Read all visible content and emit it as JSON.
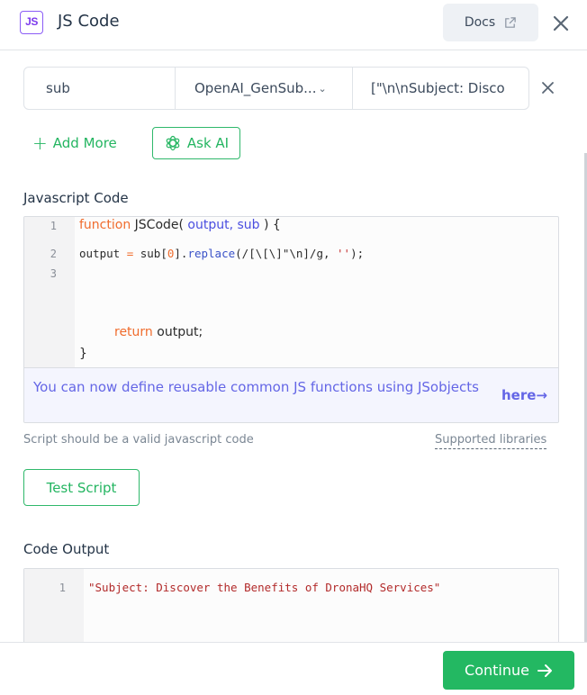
{
  "header": {
    "badge": "JS",
    "title": "JS Code",
    "docs_label": "Docs"
  },
  "params": [
    {
      "name": "sub",
      "source": "OpenAI_GenSub...",
      "value": "[\"\\n\\nSubject: Disco"
    }
  ],
  "actions": {
    "add_more": "Add More",
    "ask_ai": "Ask AI"
  },
  "editor": {
    "label": "Javascript Code",
    "line_numbers": [
      "1",
      "2",
      "3"
    ],
    "lines": {
      "l1_kw": "function",
      "l1_name": " JSCode( ",
      "l1_params": "output, sub",
      "l1_end": " ) {",
      "l2_a": "output ",
      "l2_eq": "=",
      "l2_b": " sub[",
      "l2_idx": "0",
      "l2_c": "].",
      "l2_fn": "replace",
      "l2_d": "(/[\\[\\]\"\\n]/g, ",
      "l2_str": "''",
      "l2_e": ");",
      "ret_kw": "return",
      "ret_rest": " output;",
      "close": "}"
    },
    "hint_text": "You can now define reusable common JS functions using JSobjects",
    "hint_link": "here→"
  },
  "helper_text": "Script should be a valid javascript code",
  "supported_libraries": "Supported libraries",
  "test_script": "Test Script",
  "output": {
    "label": "Code Output",
    "line_number": "1",
    "value": "\"Subject: Discover the Benefits of DronaHQ Services\""
  },
  "footer": {
    "continue_label": "Continue"
  },
  "colors": {
    "accent_green": "#23b862",
    "js_purple": "#7c3aed",
    "hint_blue": "#6466e6"
  }
}
